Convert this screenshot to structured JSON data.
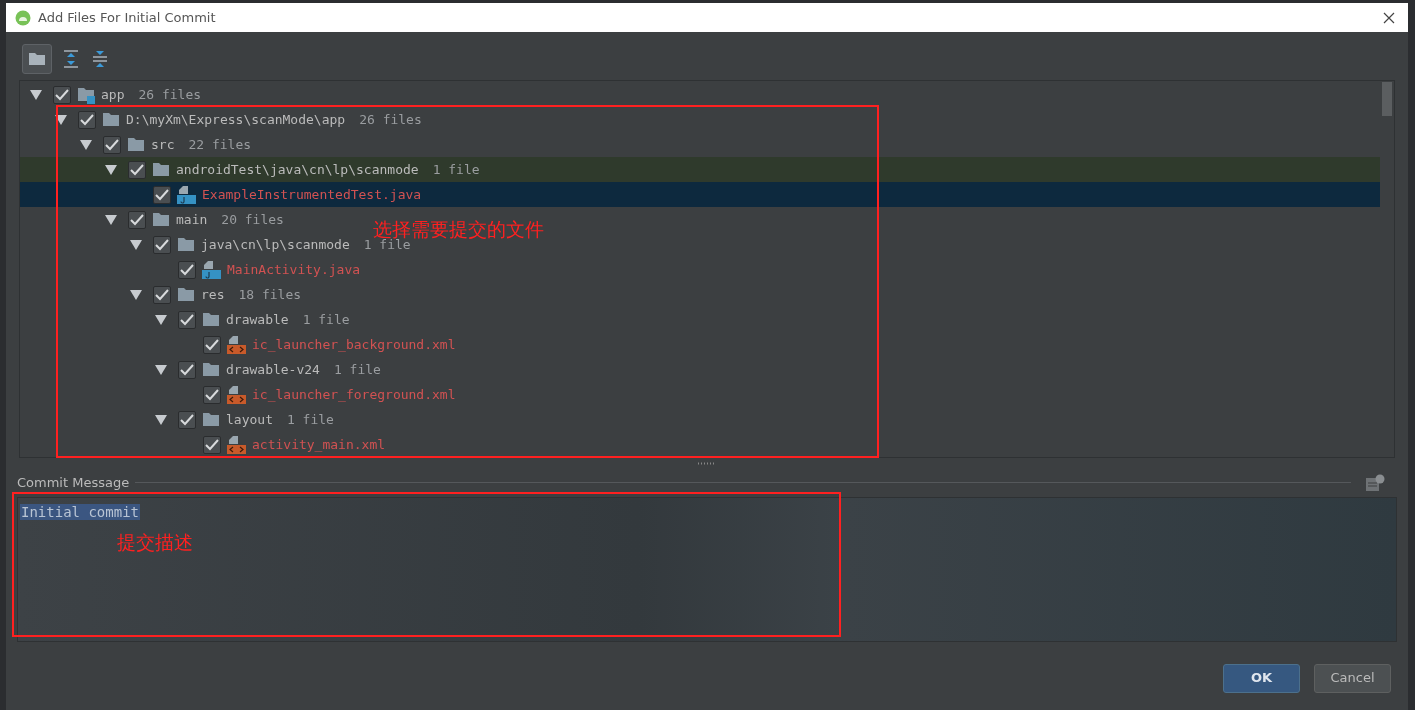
{
  "window": {
    "title": "Add Files For Initial Commit"
  },
  "tree": [
    {
      "kind": "module",
      "name": "app",
      "count": "26 files",
      "checked": true,
      "expanded": true,
      "selected": false,
      "hovered": false,
      "children": [
        {
          "kind": "folder",
          "name": "D:\\myXm\\Express\\scanMode\\app",
          "count": "26 files",
          "checked": true,
          "expanded": true,
          "selected": false,
          "hovered": false,
          "children": [
            {
              "kind": "folder",
              "name": "src",
              "count": "22 files",
              "checked": true,
              "expanded": true,
              "selected": false,
              "hovered": false,
              "children": [
                {
                  "kind": "folder",
                  "name": "androidTest\\java\\cn\\lp\\scanmode",
                  "count": "1 file",
                  "checked": true,
                  "expanded": true,
                  "selected": false,
                  "hovered": true,
                  "children": [
                    {
                      "kind": "java",
                      "name": "ExampleInstrumentedTest.java",
                      "checked": true,
                      "selected": true,
                      "hovered": false
                    }
                  ]
                },
                {
                  "kind": "folder",
                  "name": "main",
                  "count": "20 files",
                  "checked": true,
                  "expanded": true,
                  "selected": false,
                  "hovered": false,
                  "children": [
                    {
                      "kind": "folder",
                      "name": "java\\cn\\lp\\scanmode",
                      "count": "1 file",
                      "checked": true,
                      "expanded": true,
                      "selected": false,
                      "hovered": false,
                      "children": [
                        {
                          "kind": "java",
                          "name": "MainActivity.java",
                          "checked": true,
                          "selected": false,
                          "hovered": false
                        }
                      ]
                    },
                    {
                      "kind": "folder",
                      "name": "res",
                      "count": "18 files",
                      "checked": true,
                      "expanded": true,
                      "selected": false,
                      "hovered": false,
                      "children": [
                        {
                          "kind": "folder",
                          "name": "drawable",
                          "count": "1 file",
                          "checked": true,
                          "expanded": true,
                          "selected": false,
                          "hovered": false,
                          "children": [
                            {
                              "kind": "xml",
                              "name": "ic_launcher_background.xml",
                              "checked": true,
                              "selected": false,
                              "hovered": false
                            }
                          ]
                        },
                        {
                          "kind": "folder",
                          "name": "drawable-v24",
                          "count": "1 file",
                          "checked": true,
                          "expanded": true,
                          "selected": false,
                          "hovered": false,
                          "children": [
                            {
                              "kind": "xml",
                              "name": "ic_launcher_foreground.xml",
                              "checked": true,
                              "selected": false,
                              "hovered": false
                            }
                          ]
                        },
                        {
                          "kind": "folder",
                          "name": "layout",
                          "count": "1 file",
                          "checked": true,
                          "expanded": true,
                          "selected": false,
                          "hovered": false,
                          "children": [
                            {
                              "kind": "xml",
                              "name": "activity_main.xml",
                              "checked": true,
                              "selected": false,
                              "hovered": false
                            }
                          ]
                        }
                      ]
                    }
                  ]
                }
              ]
            }
          ]
        }
      ]
    }
  ],
  "commit_message": {
    "label": "Commit Message",
    "value": "Initial commit"
  },
  "buttons": [
    {
      "label": "OK",
      "kind": "primary"
    },
    {
      "label": "Cancel",
      "kind": "secondary"
    }
  ],
  "annotations": [
    {
      "text": "选择需要提交的文件"
    },
    {
      "text": "提交描述"
    }
  ]
}
